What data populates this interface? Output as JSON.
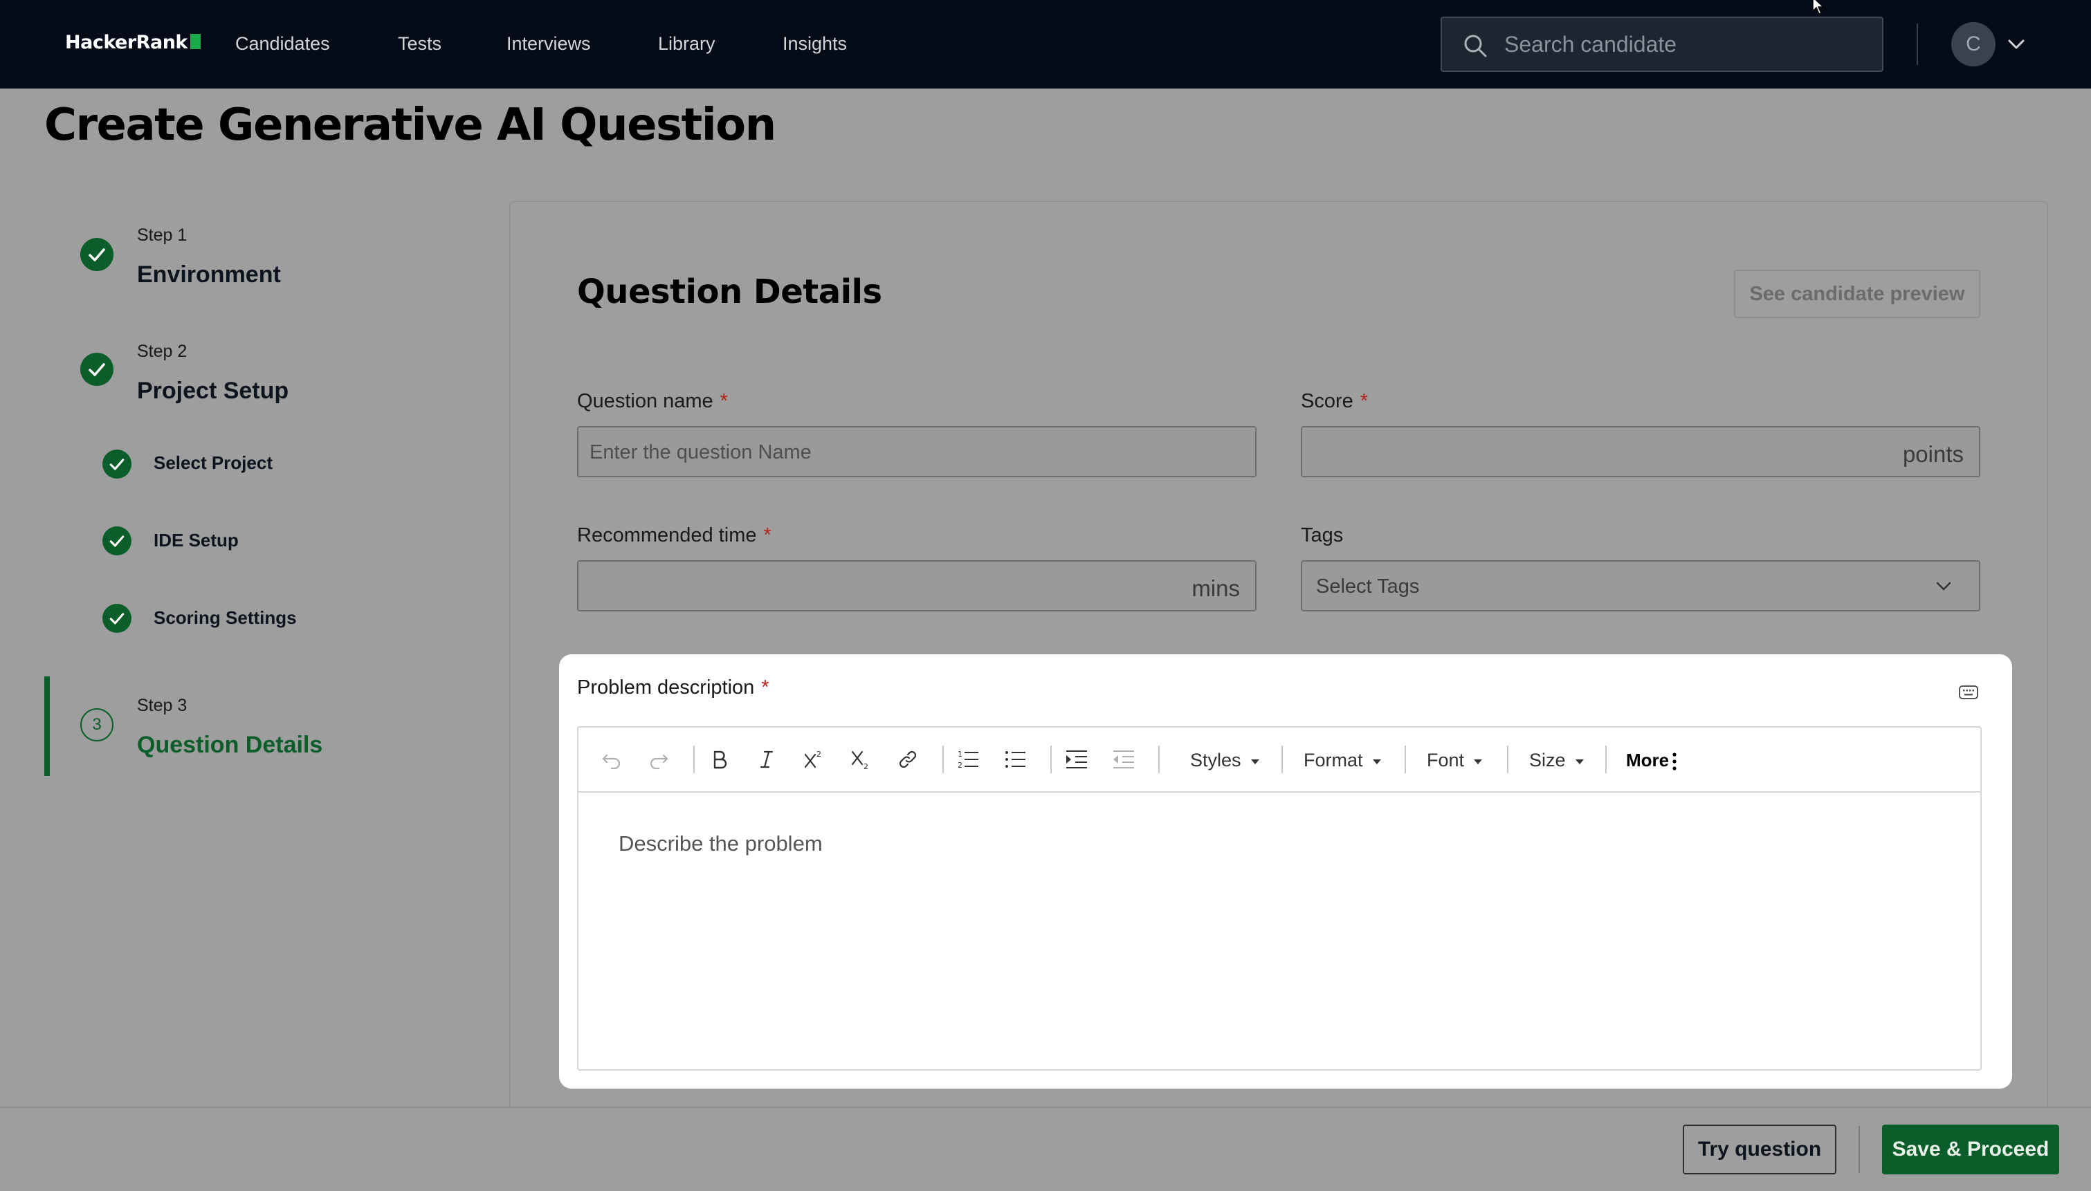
{
  "brand": {
    "name": "HackerRank",
    "accent": "#1ba94c"
  },
  "nav": {
    "items": [
      {
        "label": "Candidates"
      },
      {
        "label": "Tests"
      },
      {
        "label": "Interviews"
      },
      {
        "label": "Library"
      },
      {
        "label": "Insights"
      }
    ],
    "search": {
      "placeholder": "Search candidate",
      "icon": "search-icon"
    },
    "avatar_initial": "C"
  },
  "page": {
    "title": "Create Generative AI Question"
  },
  "stepper": {
    "steps": [
      {
        "caption": "Step 1",
        "title": "Environment",
        "status": "complete"
      },
      {
        "caption": "Step 2",
        "title": "Project Setup",
        "status": "complete",
        "substeps": [
          {
            "label": "Select Project",
            "status": "complete"
          },
          {
            "label": "IDE Setup",
            "status": "complete"
          },
          {
            "label": "Scoring Settings",
            "status": "complete"
          }
        ]
      },
      {
        "caption": "Step 3",
        "number": "3",
        "title": "Question Details",
        "status": "active"
      }
    ],
    "active_color": "#0b5d29"
  },
  "details": {
    "title": "Question Details",
    "preview_label": "See candidate preview",
    "required_mark": "*",
    "question_name": {
      "label": "Question name",
      "placeholder": "Enter the question Name",
      "value": ""
    },
    "score": {
      "label": "Score",
      "suffix": "points",
      "value": ""
    },
    "recommended_time": {
      "label": "Recommended time",
      "suffix": "mins",
      "value": ""
    },
    "tags": {
      "label": "Tags",
      "placeholder": "Select Tags"
    },
    "problem_description": {
      "label": "Problem description",
      "placeholder": "Describe the problem",
      "toolbar": {
        "styles": "Styles",
        "format": "Format",
        "font": "Font",
        "size": "Size",
        "more": "More"
      }
    }
  },
  "footer": {
    "try_label": "Try question",
    "save_label": "Save & Proceed"
  }
}
